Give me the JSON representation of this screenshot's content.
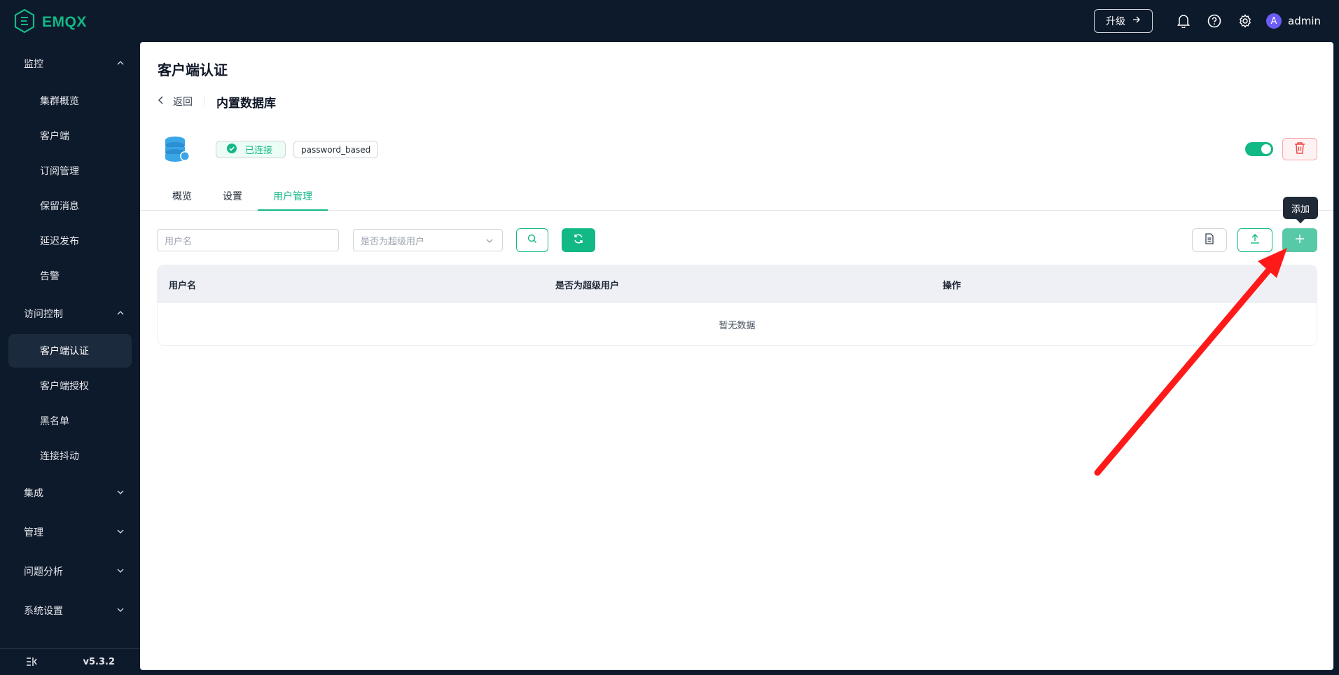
{
  "app": {
    "brand": "EMQX",
    "version": "v5.3.2"
  },
  "topbar": {
    "upgrade_label": "升级",
    "user_initial": "A",
    "username": "admin"
  },
  "sidebar": {
    "groups": [
      {
        "label": "监控",
        "items": [
          "集群概览",
          "客户端",
          "订阅管理",
          "保留消息",
          "延迟发布",
          "告警"
        ]
      },
      {
        "label": "访问控制",
        "items": [
          "客户端认证",
          "客户端授权",
          "黑名单",
          "连接抖动"
        ]
      },
      {
        "label": "集成"
      },
      {
        "label": "管理"
      },
      {
        "label": "问题分析"
      },
      {
        "label": "系统设置"
      }
    ]
  },
  "page": {
    "title": "客户端认证",
    "back_label": "返回",
    "subtitle": "内置数据库",
    "status_label": "已连接",
    "mechanism": "password_based",
    "enabled": true
  },
  "tabs": [
    "概览",
    "设置",
    "用户管理"
  ],
  "active_tab": "用户管理",
  "filters": {
    "username_placeholder": "用户名",
    "superuser_placeholder": "是否为超级用户"
  },
  "tooltip": {
    "add": "添加"
  },
  "table": {
    "columns": [
      "用户名",
      "是否为超级用户",
      "操作"
    ],
    "empty_text": "暂无数据"
  },
  "colors": {
    "accent": "#12b886",
    "sidebar_bg": "#0d1a2b",
    "annotation": "#ff1a1a"
  }
}
